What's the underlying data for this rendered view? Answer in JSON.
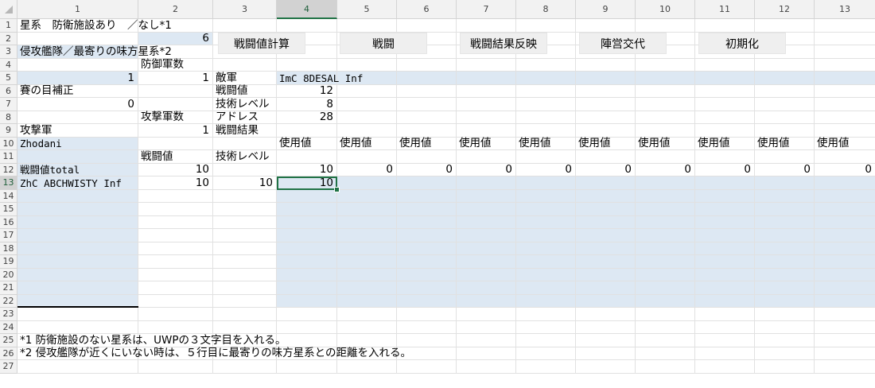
{
  "sheet": {
    "column_headers": [
      "1",
      "2",
      "3",
      "4",
      "5",
      "6",
      "7",
      "8",
      "9",
      "10",
      "11",
      "12",
      "13"
    ],
    "row_headers": [
      "1",
      "2",
      "3",
      "4",
      "5",
      "6",
      "7",
      "8",
      "9",
      "10",
      "11",
      "12",
      "13",
      "14",
      "15",
      "16",
      "17",
      "18",
      "19",
      "20",
      "21",
      "22",
      "23",
      "24",
      "25",
      "26",
      "27"
    ],
    "selected_cell": "4-13",
    "cells": {
      "r1c1": "星系　防衛施設あり　／なし*1",
      "r2c2": "6",
      "r3c1": "侵攻艦隊／最寄りの味方星系*2",
      "r4c2": "防御軍数",
      "r5c1": "1",
      "r5c2": "1",
      "r5c3": "敵軍",
      "r5c4": "ImC 8DESAL Inf",
      "r6c1": "賽の目補正",
      "r6c3": "戦闘値",
      "r6c4": "12",
      "r7c1": "0",
      "r7c3": "技術レベル",
      "r7c4": "8",
      "r8c2": "攻撃軍数",
      "r8c3": "アドレス",
      "r8c4": "28",
      "r9c1": "攻撃軍",
      "r9c2": "1",
      "r9c3": "戦闘結果",
      "r10c1": "Zhodani",
      "r10c4": "使用値",
      "r10c5": "使用値",
      "r10c6": "使用値",
      "r10c7": "使用値",
      "r10c8": "使用値",
      "r10c9": "使用値",
      "r10c10": "使用値",
      "r10c11": "使用値",
      "r10c12": "使用値",
      "r10c13": "使用値",
      "r11c2": "戦闘値",
      "r11c3": "技術レベル",
      "r12c1": "戦闘値total",
      "r12c2": "10",
      "r12c4": "10",
      "r12c5": "0",
      "r12c6": "0",
      "r12c7": "0",
      "r12c8": "0",
      "r12c9": "0",
      "r12c10": "0",
      "r12c11": "0",
      "r12c12": "0",
      "r12c13": "0",
      "r13c1": "ZhC ABCHWISTY Inf",
      "r13c2": "10",
      "r13c3": "10",
      "r13c4": "10",
      "r25c1": "*1 防衛施設のない星系は、UWPの３文字目を入れる。",
      "r26c1": "*2 侵攻艦隊が近くにいない時は、５行目に最寄りの味方星系との距離を入れる。"
    }
  },
  "buttons": {
    "calc": "戦闘値計算",
    "battle": "戦闘",
    "apply": "戦闘結果反映",
    "swap": "陣営交代",
    "init": "初期化"
  },
  "colors": {
    "fill_blue": "#dde8f3",
    "selection_green": "#217346",
    "header_gray": "#f2f2f2"
  }
}
